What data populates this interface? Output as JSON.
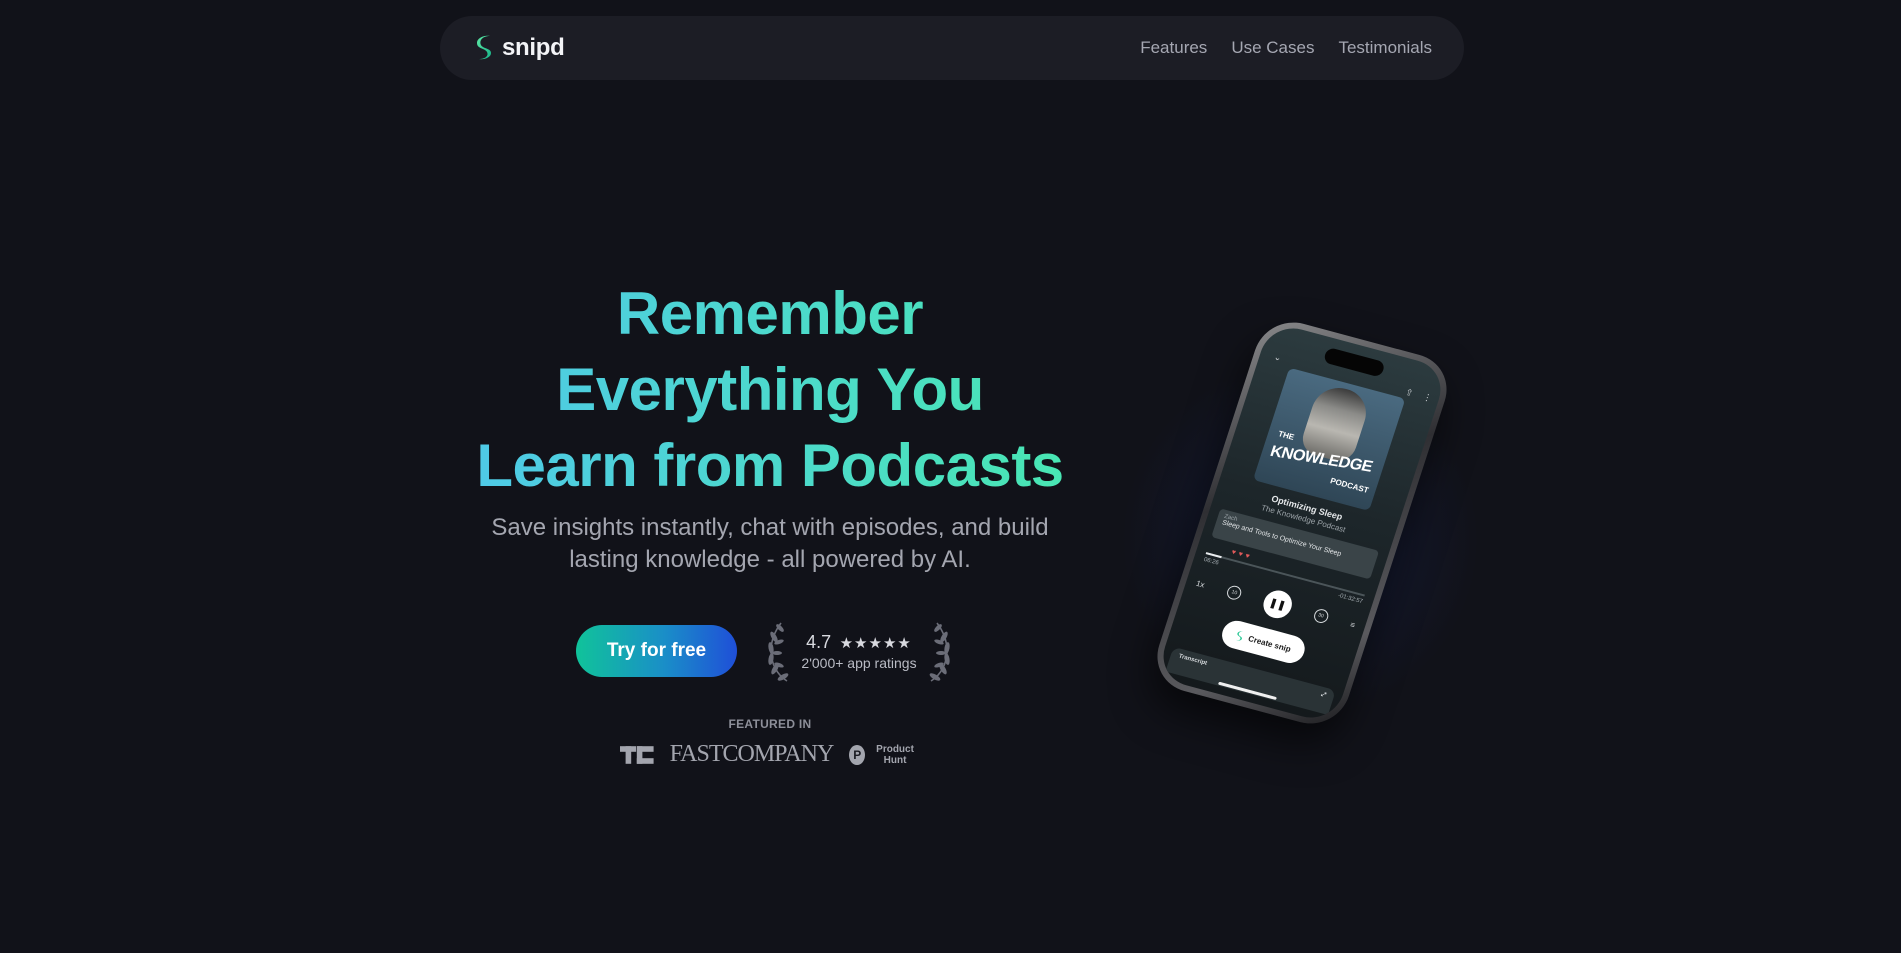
{
  "nav": {
    "brand": "snipd",
    "links": [
      "Features",
      "Use Cases",
      "Testimonials"
    ]
  },
  "hero": {
    "headline": [
      "Remember",
      "Everything You",
      "Learn from Podcasts"
    ],
    "subtitle": [
      "Save insights instantly, chat with episodes, and build",
      "lasting knowledge - all powered by AI."
    ],
    "cta": "Try for free",
    "rating": {
      "score": "4.7",
      "stars": "★★★★★",
      "label": "2'000+ app ratings"
    }
  },
  "featured": {
    "label": "FEATURED IN",
    "logos": [
      "FASTCOMPANY",
      "Product Hunt"
    ]
  },
  "phone": {
    "cover_the": "THE",
    "cover_title": "KNOWLEDGE",
    "cover_podcast": "PODCAST",
    "episode_title": "Optimizing Sleep",
    "episode_show": "The Knowledge Podcast",
    "chapter_tag": "Zach",
    "chapter_text": "Sleep and Tools to Optimize Your Sleep",
    "time_elapsed": "06:26",
    "time_remaining": "-01:32:57",
    "speed": "1x",
    "skip_back": "10",
    "skip_fwd": "30",
    "create_snip": "Create snip",
    "transcript": "Transcript"
  },
  "colors": {
    "background": "#111219",
    "headline_gradient": [
      "#4fc8ea",
      "#48e8b0"
    ],
    "cta_gradient": [
      "#10c39a",
      "#1f4fd8"
    ]
  }
}
